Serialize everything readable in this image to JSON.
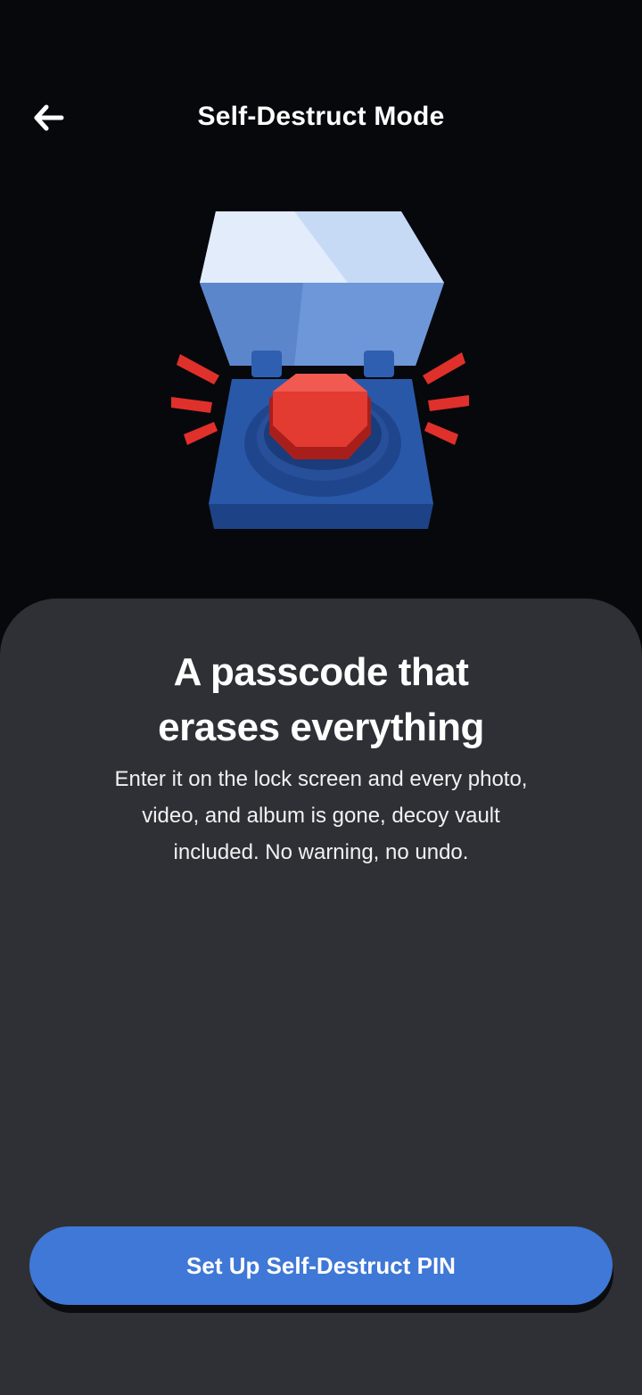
{
  "header": {
    "title": "Self-Destruct Mode",
    "back_icon": "arrow-left-icon"
  },
  "hero": {
    "illustration": "red-button-box-illustration"
  },
  "content": {
    "headline_line1": "A passcode that",
    "headline_line2": "erases everything",
    "description_line1": "Enter it on the lock screen and every photo,",
    "description_line2": "video, and album is gone, decoy vault",
    "description_line3": "included. No warning, no undo."
  },
  "cta": {
    "label": "Set Up Self-Destruct PIN"
  },
  "colors": {
    "background": "#07080b",
    "sheet": "#2f3035",
    "accent": "#3f78d6",
    "alert_red": "#e0302b"
  }
}
